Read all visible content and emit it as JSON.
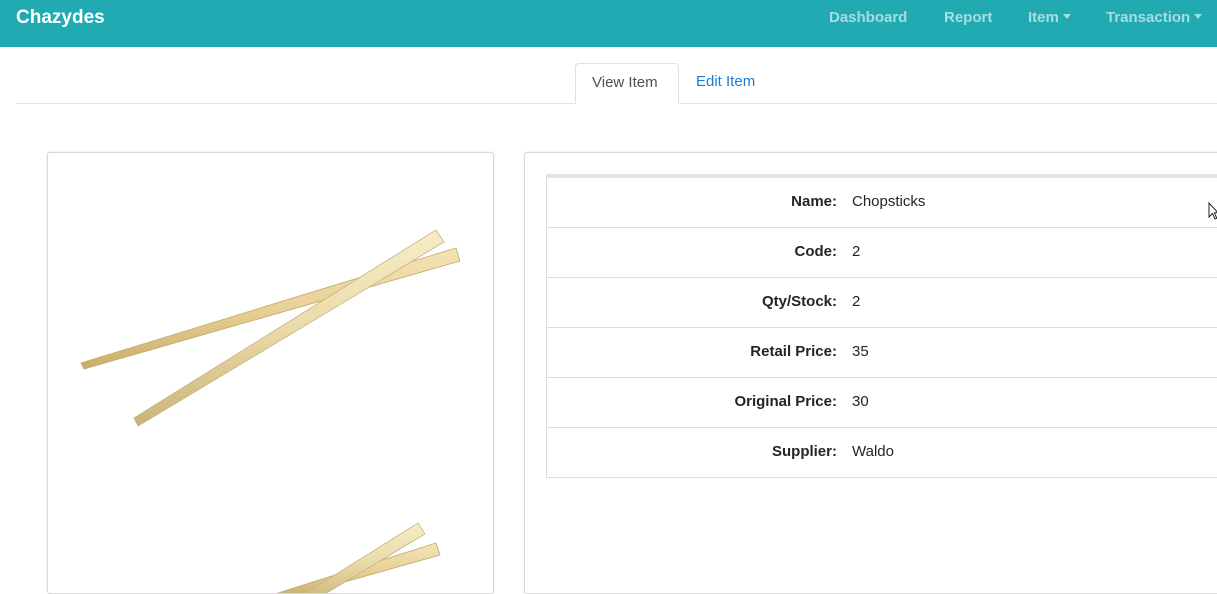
{
  "navbar": {
    "brand": "Chazydes",
    "background": "#22aab3",
    "links": [
      {
        "label": "Dashboard",
        "dropdown": false
      },
      {
        "label": "Report",
        "dropdown": false
      },
      {
        "label": "Item",
        "dropdown": true
      },
      {
        "label": "Transaction",
        "dropdown": true
      }
    ]
  },
  "tabs": [
    {
      "label": "View Item",
      "active": true
    },
    {
      "label": "Edit Item",
      "active": false
    }
  ],
  "image": {
    "icon": "chopsticks-photo"
  },
  "details": [
    {
      "label": "Name:",
      "value": "Chopsticks"
    },
    {
      "label": "Code:",
      "value": "2"
    },
    {
      "label": "Qty/Stock:",
      "value": "2"
    },
    {
      "label": "Retail Price:",
      "value": "35"
    },
    {
      "label": "Original Price:",
      "value": "30"
    },
    {
      "label": "Supplier:",
      "value": "Waldo"
    }
  ]
}
